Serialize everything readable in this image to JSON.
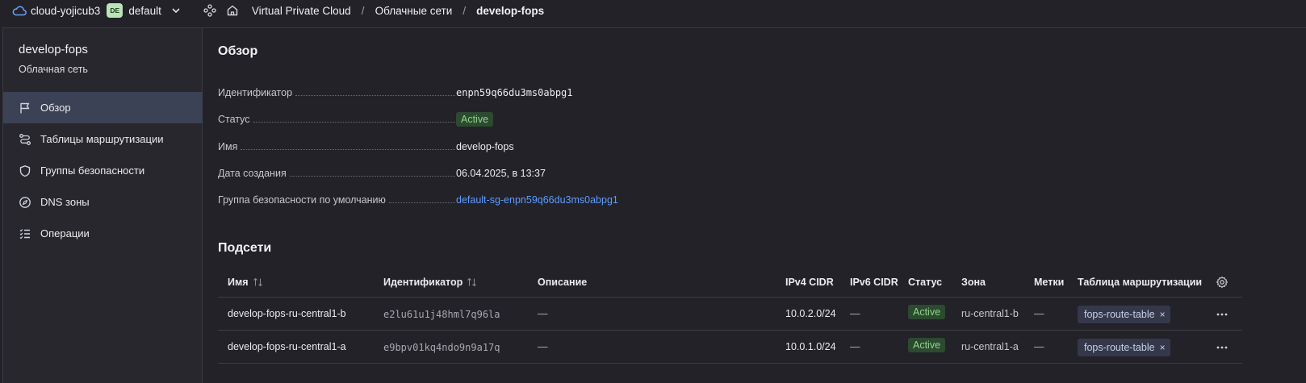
{
  "topbar": {
    "cloud_name": "cloud-yojicub3",
    "folder_badge": "DE",
    "folder_name": "default",
    "breadcrumbs": [
      "Virtual Private Cloud",
      "Облачные сети",
      "develop-fops"
    ],
    "separator": "/"
  },
  "sidebar": {
    "title": "develop-fops",
    "subtitle": "Облачная сеть",
    "items": [
      {
        "label": "Обзор",
        "icon": "flag-icon",
        "active": true
      },
      {
        "label": "Таблицы маршрутизации",
        "icon": "route-icon",
        "active": false
      },
      {
        "label": "Группы безопасности",
        "icon": "shield-icon",
        "active": false
      },
      {
        "label": "DNS зоны",
        "icon": "compass-icon",
        "active": false
      },
      {
        "label": "Операции",
        "icon": "list-icon",
        "active": false
      }
    ]
  },
  "overview": {
    "title": "Обзор",
    "properties": [
      {
        "label": "Идентификатор",
        "value": "enpn59q66du3ms0abpg1"
      },
      {
        "label": "Статус",
        "value": "Active"
      },
      {
        "label": "Имя",
        "value": "develop-fops"
      },
      {
        "label": "Дата создания",
        "value": "06.04.2025, в 13:37"
      },
      {
        "label": "Группа безопасности по умолчанию",
        "value": "default-sg-enpn59q66du3ms0abpg1"
      }
    ]
  },
  "subnets": {
    "title": "Подсети",
    "columns": [
      "Имя",
      "Идентификатор",
      "Описание",
      "IPv4 CIDR",
      "IPv6 CIDR",
      "Статус",
      "Зона",
      "Метки",
      "Таблица маршрутизации"
    ],
    "rows": [
      {
        "name": "develop-fops-ru-central1-b",
        "id": "e2lu61u1j48hml7q96la",
        "description": "—",
        "ipv4": "10.0.2.0/24",
        "ipv6": "—",
        "status": "Active",
        "zone": "ru-central1-b",
        "labels": "—",
        "route_table": "fops-route-table",
        "remove": "×"
      },
      {
        "name": "develop-fops-ru-central1-a",
        "id": "e9bpv01kq4ndo9n9a17q",
        "description": "—",
        "ipv4": "10.0.1.0/24",
        "ipv6": "—",
        "status": "Active",
        "zone": "ru-central1-a",
        "labels": "—",
        "route_table": "fops-route-table",
        "remove": "×"
      }
    ]
  },
  "colors": {
    "accent_link": "#5e9cff",
    "active_badge_bg": "#2c4a2f",
    "active_badge_text": "#8fd58f",
    "nav_active_bg": "#3b4256"
  }
}
